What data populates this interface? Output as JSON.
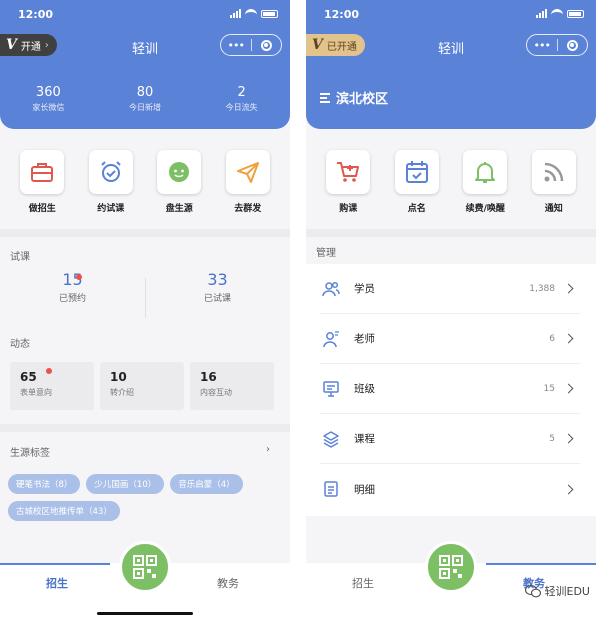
{
  "left": {
    "status_time": "12:00",
    "vip_label": "开通",
    "nav_title": "轻训",
    "stats": [
      {
        "value": "360",
        "label": "家长微信"
      },
      {
        "value": "80",
        "label": "今日新增"
      },
      {
        "value": "2",
        "label": "今日流失"
      }
    ],
    "quick_actions": [
      {
        "label": "做招生",
        "icon": "briefcase-icon"
      },
      {
        "label": "约试课",
        "icon": "alarm-clock-icon"
      },
      {
        "label": "盘生源",
        "icon": "smiley-face-icon"
      },
      {
        "label": "去群发",
        "icon": "paper-plane-icon"
      }
    ],
    "trial_title": "试课",
    "trial": [
      {
        "value": "15",
        "label": "已预约"
      },
      {
        "value": "33",
        "label": "已试课"
      }
    ],
    "dynamic_title": "动态",
    "dynamics": [
      {
        "value": "65",
        "label": "表单意向"
      },
      {
        "value": "10",
        "label": "转介绍"
      },
      {
        "value": "16",
        "label": "内容互动"
      }
    ],
    "tags_title": "生源标签",
    "tags_arrow": "›",
    "tags": [
      "硬笔书法（8）",
      "少儿国画（10）",
      "音乐启蒙（4）",
      "古城校区地推传单（43）"
    ],
    "tabs": {
      "left": "招生",
      "right": "教务"
    }
  },
  "right": {
    "status_time": "12:00",
    "vip_label": "已开通",
    "nav_title": "轻训",
    "campus": "滨北校区",
    "quick_actions": [
      {
        "label": "购课",
        "icon": "shopping-cart-icon"
      },
      {
        "label": "点名",
        "icon": "calendar-check-icon"
      },
      {
        "label": "续费/唤醒",
        "icon": "bell-icon"
      },
      {
        "label": "通知",
        "icon": "rss-icon"
      }
    ],
    "mgmt_title": "管理",
    "mgmt_rows": [
      {
        "label": "学员",
        "count": "1,388",
        "icon": "students-icon"
      },
      {
        "label": "老师",
        "count": "6",
        "icon": "teacher-icon"
      },
      {
        "label": "班级",
        "count": "15",
        "icon": "class-board-icon"
      },
      {
        "label": "课程",
        "count": "5",
        "icon": "layers-icon"
      },
      {
        "label": "明细",
        "count": "",
        "icon": "list-doc-icon"
      }
    ],
    "tabs": {
      "left": "招生",
      "right": "教务"
    }
  },
  "watermark": "轻训EDU",
  "colors": {
    "primary": "#5a82d6",
    "accent_green": "#7dbf64",
    "badge_red": "#e8534c",
    "tag_bg": "#aac0e8"
  }
}
